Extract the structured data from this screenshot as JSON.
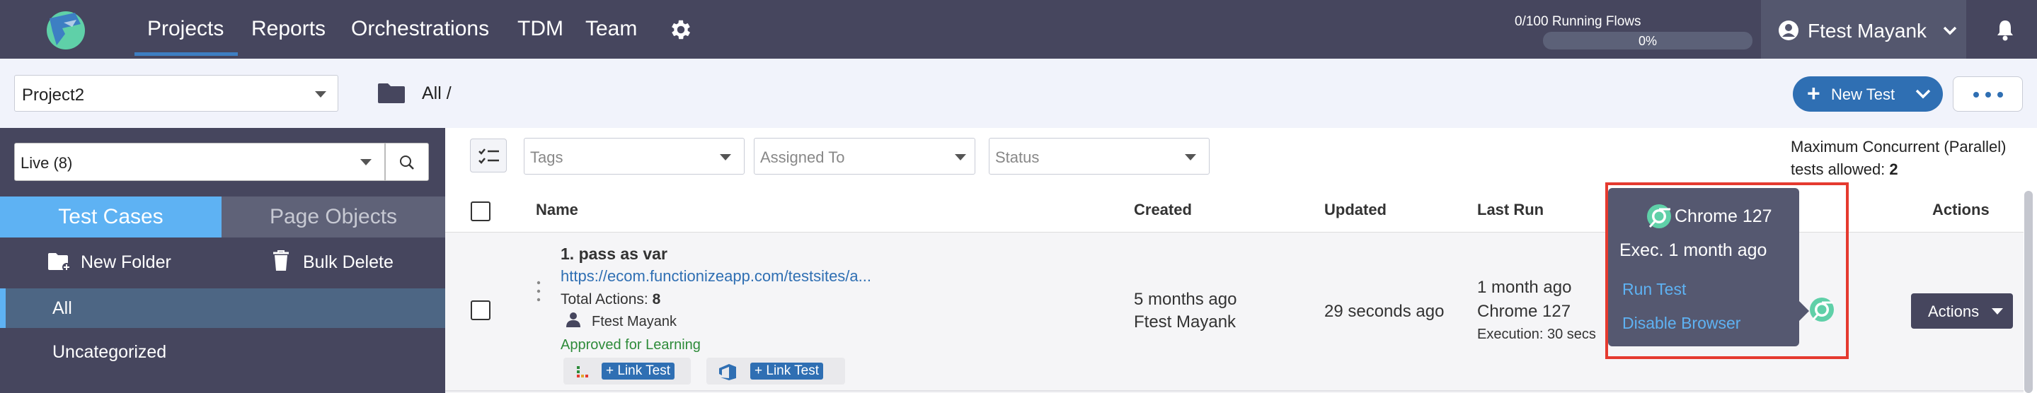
{
  "nav": {
    "items": [
      "Projects",
      "Reports",
      "Orchestrations",
      "TDM",
      "Team"
    ],
    "running_flows": "0/100 Running Flows",
    "running_flows_pct": "0%",
    "user_name": "Ftest Mayank"
  },
  "subbar": {
    "project": "Project2",
    "breadcrumb": "All /",
    "new_test": "New Test"
  },
  "sidebar": {
    "filter_value": "Live (8)",
    "tabs": [
      "Test Cases",
      "Page Objects"
    ],
    "new_folder": "New Folder",
    "bulk_delete": "Bulk Delete",
    "folders": [
      "All",
      "Uncategorized"
    ]
  },
  "filters": {
    "tags": "Tags",
    "assigned_to": "Assigned To",
    "status": "Status",
    "max_concurrent": "Maximum Concurrent (Parallel) tests allowed:",
    "max_concurrent_value": "2"
  },
  "table": {
    "headers": {
      "name": "Name",
      "created": "Created",
      "updated": "Updated",
      "last_run": "Last Run",
      "actions": "Actions"
    },
    "row": {
      "title": "1. pass as var",
      "url": "https://ecom.functionizeapp.com/testsites/a...",
      "total_actions_label": "Total Actions:",
      "total_actions": "8",
      "user": "Ftest Mayank",
      "approved": "Approved for Learning",
      "link_test_1": "+ Link Test",
      "link_test_2": "+ Link Test",
      "created_ago": "5 months ago",
      "created_by": "Ftest Mayank",
      "updated": "29 seconds ago",
      "last_run_ago": "1 month ago",
      "last_run_browser": "Chrome 127",
      "execution": "Execution: 30 secs",
      "actions_button": "Actions"
    }
  },
  "tooltip": {
    "browser": "Chrome 127",
    "exec": "Exec. 1 month ago",
    "run_test": "Run Test",
    "disable_browser": "Disable Browser"
  },
  "colors": {
    "nav_bg": "#46465e",
    "accent": "#5eb2f3",
    "primary": "#2f6fb3",
    "highlight": "#e53a2f"
  }
}
